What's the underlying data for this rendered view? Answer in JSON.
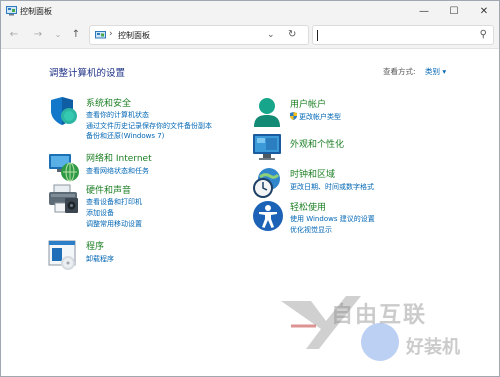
{
  "window": {
    "title": "控制面板",
    "minimize_glyph": "—",
    "maximize_glyph": "☐",
    "close_glyph": "✕"
  },
  "nav": {
    "back_glyph": "←",
    "forward_glyph": "→",
    "recent_glyph": "⌄",
    "up_glyph": "↑",
    "breadcrumb_sep": "›",
    "address": "控制面板",
    "dropdown_glyph": "⌄",
    "refresh_glyph": "↻",
    "search_placeholder": "",
    "search_glyph": "⚲"
  },
  "main": {
    "title": "调整计算机的设置",
    "view_by_label": "查看方式:",
    "view_by_value": "类别 ▾"
  },
  "categories": [
    {
      "title": "系统和安全",
      "icon": "shield-icon",
      "links": [
        "查看你的计算机状态",
        "通过文件历史记录保存你的文件备份副本",
        "备份和还原(Windows 7)"
      ]
    },
    {
      "title": "网络和 Internet",
      "icon": "network-globe-icon",
      "links": [
        "查看网络状态和任务"
      ]
    },
    {
      "title": "硬件和声音",
      "icon": "printer-icon",
      "links": [
        "查看设备和打印机",
        "添加设备",
        "调整常用移动设置"
      ]
    },
    {
      "title": "程序",
      "icon": "programs-icon",
      "links": [
        "卸载程序"
      ]
    },
    {
      "title": "用户帐户",
      "icon": "user-icon",
      "links": [
        "更改帐户类型"
      ]
    },
    {
      "title": "外观和个性化",
      "icon": "monitor-icon",
      "links": []
    },
    {
      "title": "时钟和区域",
      "icon": "clock-globe-icon",
      "links": [
        "更改日期、时间或数字格式"
      ]
    },
    {
      "title": "轻松使用",
      "icon": "accessibility-icon",
      "links": [
        "使用 Windows 建议的设置",
        "优化视觉显示"
      ]
    }
  ],
  "watermark": {
    "text1": "自由互联",
    "text2": "好装机"
  },
  "colors": {
    "category_title": "#1c7f24",
    "link": "#0066b4",
    "page_title": "#1e3287"
  }
}
